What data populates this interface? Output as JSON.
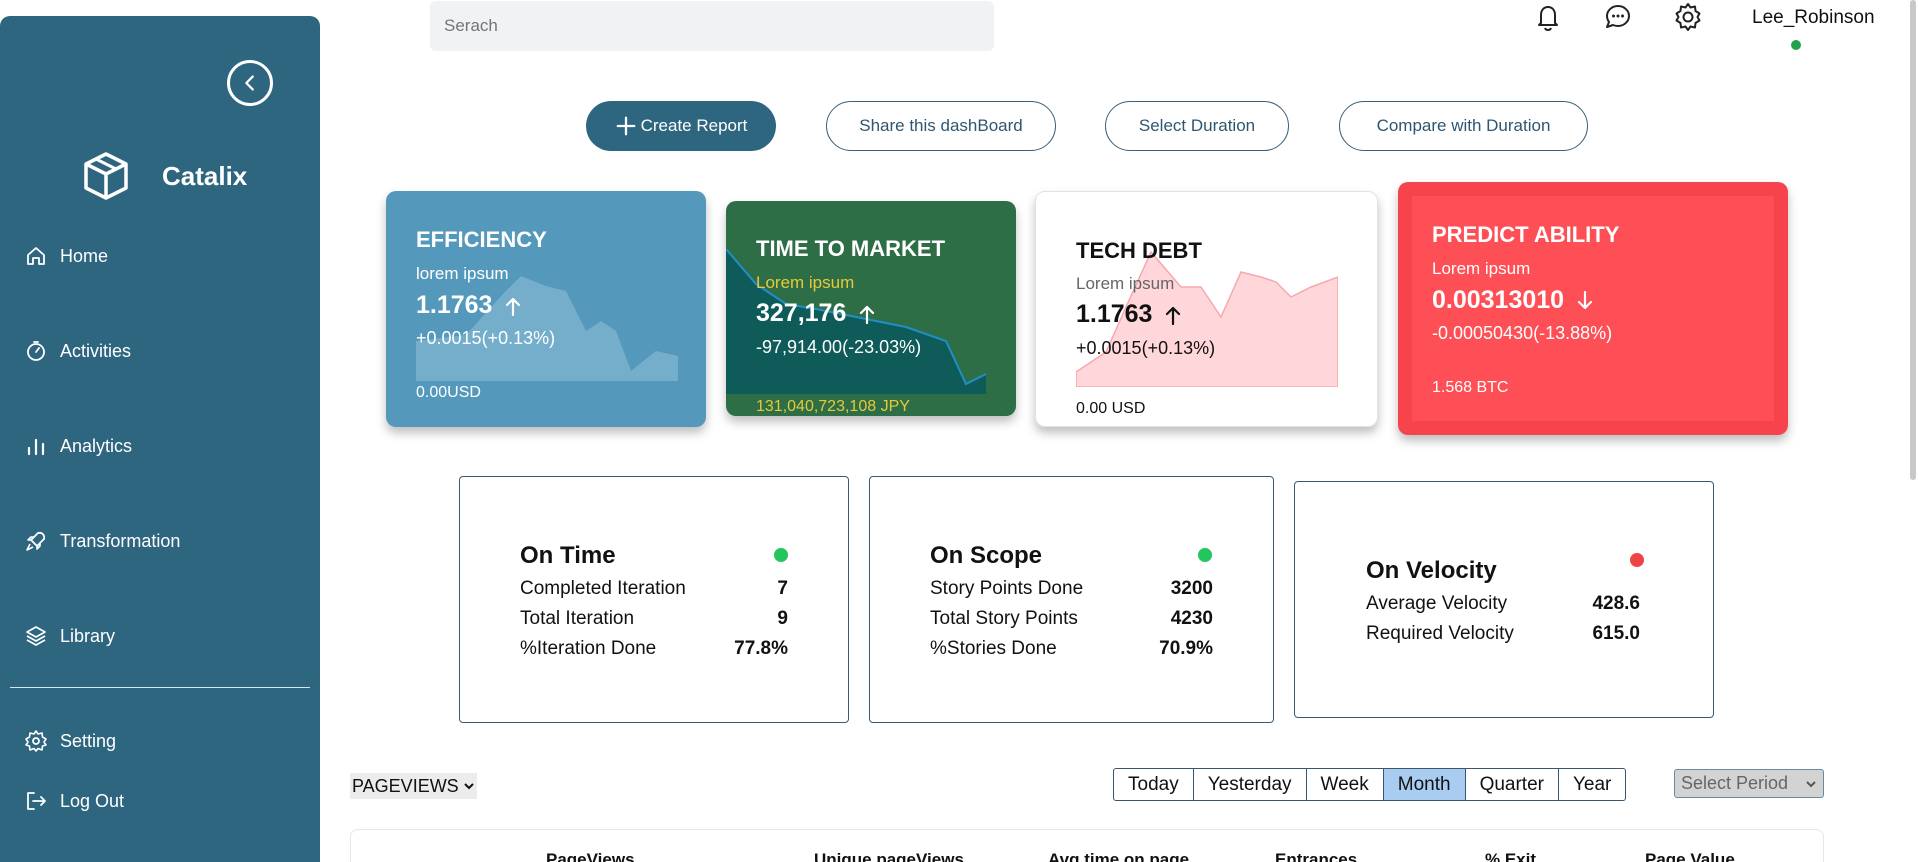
{
  "sidebar": {
    "brand": "Catalix",
    "items": [
      {
        "label": "Home",
        "icon": "home-icon"
      },
      {
        "label": "Activities",
        "icon": "timer-icon"
      },
      {
        "label": "Analytics",
        "icon": "bar-chart-icon"
      },
      {
        "label": "Transformation",
        "icon": "rocket-icon"
      },
      {
        "label": "Library",
        "icon": "layers-icon"
      }
    ],
    "bottom_items": [
      {
        "label": "Setting",
        "icon": "gear-icon"
      },
      {
        "label": "Log Out",
        "icon": "logout-icon"
      }
    ]
  },
  "header": {
    "search_placeholder": "Serach",
    "username": "Lee_Robinson"
  },
  "actions": {
    "create_report": "Create Report",
    "share": "Share this dashBoard",
    "select_duration": "Select Duration",
    "compare": "Compare with Duration"
  },
  "kpis": [
    {
      "title": "EFFICIENCY",
      "sub": "lorem ipsum",
      "value": "1.1763",
      "trend": "up",
      "change": "+0.0015(+0.13%)",
      "foot": "0.00USD",
      "bg": "#5499bb"
    },
    {
      "title": "TIME TO MARKET",
      "sub": "Lorem ipsum",
      "value": "327,176",
      "trend": "up",
      "change": "-97,914.00(-23.03%)",
      "foot": "131,040,723,108 JPY",
      "bg": "#2d6e47"
    },
    {
      "title": "TECH DEBT",
      "sub": "Lorem ipsum",
      "value": "1.1763",
      "trend": "up",
      "change": "+0.0015(+0.13%)",
      "foot": "0.00 USD",
      "bg": "#ffffff"
    },
    {
      "title": "PREDICT ABILITY",
      "sub": "Lorem ipsum",
      "value": "0.00313010",
      "trend": "down",
      "change": "-0.00050430(-13.88%)",
      "foot": "1.568 BTC",
      "bg": "#fb4b51"
    }
  ],
  "status_cards": [
    {
      "title": "On Time",
      "status_color": "#22c55e",
      "rows": [
        {
          "label": "Completed Iteration",
          "value": "7"
        },
        {
          "label": "Total Iteration",
          "value": "9"
        },
        {
          "label": "%Iteration Done",
          "value": "77.8%"
        }
      ]
    },
    {
      "title": "On Scope",
      "status_color": "#22c55e",
      "rows": [
        {
          "label": "Story Points Done",
          "value": "3200"
        },
        {
          "label": "Total Story Points",
          "value": "4230"
        },
        {
          "label": "%Stories Done",
          "value": "70.9%"
        }
      ]
    },
    {
      "title": "On Velocity",
      "status_color": "#ef4444",
      "rows": [
        {
          "label": "Average Velocity",
          "value": "428.6"
        },
        {
          "label": "Required Velocity",
          "value": "615.0"
        }
      ]
    }
  ],
  "pageviews": {
    "selector": "PAGEVIEWS",
    "periods": [
      "Today",
      "Yesterday",
      "Week",
      "Month",
      "Quarter",
      "Year"
    ],
    "active_period": "Month",
    "period_select": "Select Period",
    "columns": [
      "PageViews",
      "Unique pageViews",
      "Avg time on page",
      "Entrances",
      "% Exit",
      "Page Value"
    ]
  }
}
